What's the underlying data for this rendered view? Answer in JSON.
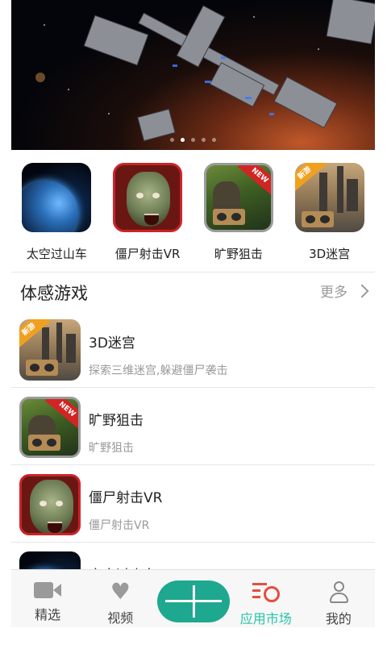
{
  "banner": {
    "dots": [
      false,
      true,
      false,
      false,
      false
    ]
  },
  "featured": [
    {
      "label": "太空过山车",
      "art": "space"
    },
    {
      "label": "僵尸射击VR",
      "art": "zombie"
    },
    {
      "label": "旷野狙击",
      "art": "jungle",
      "badge": "NEW"
    },
    {
      "label": "3D迷宫",
      "art": "maze",
      "badge": "新游"
    }
  ],
  "section": {
    "title": "体感游戏",
    "more": "更多"
  },
  "list": [
    {
      "name": "3D迷宫",
      "desc": "探索三维迷宫,躲避僵尸袭击",
      "art": "maze",
      "badge": "新游"
    },
    {
      "name": "旷野狙击",
      "desc": "旷野狙击",
      "art": "jungle",
      "badge": "NEW"
    },
    {
      "name": "僵尸射击VR",
      "desc": "僵尸射击VR",
      "art": "zombie"
    },
    {
      "name": "太空过山车",
      "desc": "",
      "art": "space"
    }
  ],
  "tabs": [
    {
      "label": "精选",
      "icon": "video-camera-icon"
    },
    {
      "label": "视频",
      "icon": "heart-icon"
    },
    {
      "label": "",
      "icon": "plus-icon"
    },
    {
      "label": "应用市场",
      "icon": "app-market-icon",
      "active": true
    },
    {
      "label": "我的",
      "icon": "user-icon"
    }
  ],
  "colors": {
    "accent": "#27c3a9",
    "center_button": "#1ea88f",
    "market_icon": "#e84c3d"
  }
}
